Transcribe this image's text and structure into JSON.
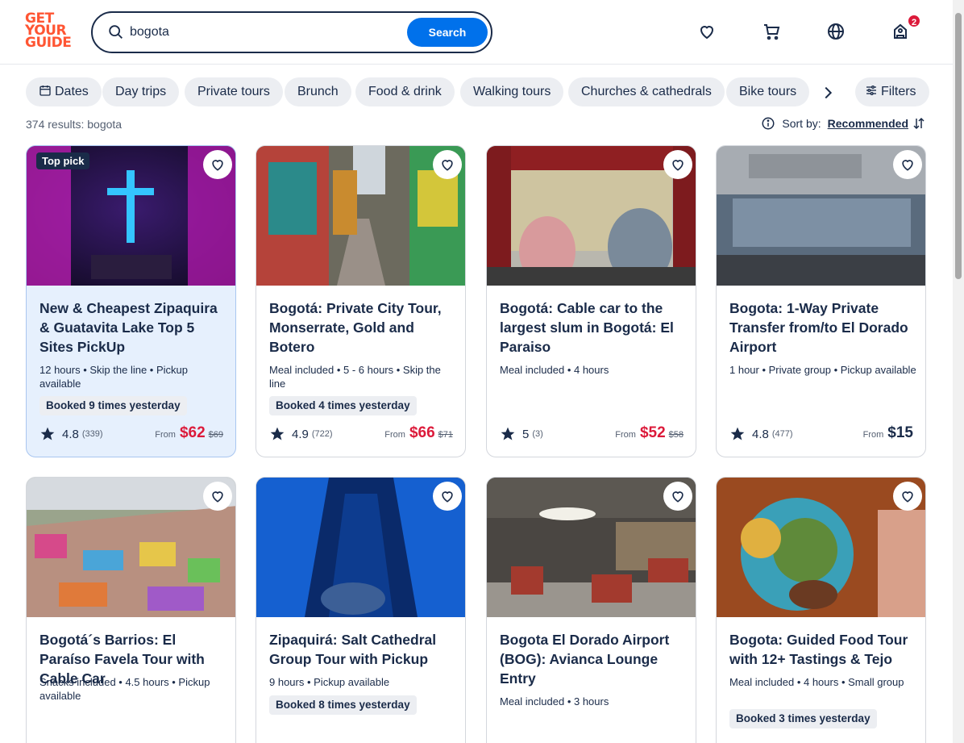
{
  "logo": {
    "line1": "GET",
    "line2": "YOUR",
    "line3": "GUIDE"
  },
  "search": {
    "value": "bogota",
    "button_label": "Search"
  },
  "header": {
    "cart_badge": "2"
  },
  "chips": [
    "Dates",
    "Day trips",
    "Private tours",
    "Brunch",
    "Food & drink",
    "Walking tours",
    "Churches & cathedrals",
    "Bike tours"
  ],
  "filters_label": "Filters",
  "results_text": "374 results: bogota",
  "sort": {
    "label": "Sort by:",
    "value": "Recommended"
  },
  "cards": [
    {
      "title": "New & Cheapest Zipaquira & Guatavita Lake Top 5 Sites PickUp",
      "meta": "12 hours • Skip the line • Pickup available",
      "booked": "Booked 9 times yesterday",
      "badge": "Top pick",
      "rating": "4.8",
      "reviews": "(339)",
      "from": "From",
      "price": "$62",
      "old_price": "$69"
    },
    {
      "title": "Bogotá: Private City Tour, Monserrate, Gold and Botero",
      "meta": "Meal included • 5 - 6 hours • Skip the line",
      "booked": "Booked 4 times yesterday",
      "rating": "4.9",
      "reviews": "(722)",
      "from": "From",
      "price": "$66",
      "old_price": "$71"
    },
    {
      "title": "Bogotá: Cable car to the largest slum in Bogotá: El Paraiso",
      "meta": "Meal included • 4 hours",
      "rating": "5",
      "reviews": "(3)",
      "from": "From",
      "price": "$52",
      "old_price": "$58"
    },
    {
      "title": "Bogota: 1-Way Private Transfer from/to El Dorado Airport",
      "meta": "1 hour • Private group • Pickup available",
      "rating": "4.8",
      "reviews": "(477)",
      "from": "From",
      "price": "$15"
    },
    {
      "title": "Bogotá´s Barrios: El Paraíso Favela Tour with Cable Car",
      "meta": "Snacks included • 4.5 hours • Pickup available"
    },
    {
      "title": "Zipaquirá: Salt Cathedral Group Tour with Pickup",
      "meta": "9 hours • Pickup available",
      "booked": "Booked 8 times yesterday"
    },
    {
      "title": "Bogota El Dorado Airport (BOG): Avianca Lounge Entry",
      "meta": "Meal included • 3 hours"
    },
    {
      "title": "Bogota: Guided Food Tour with 12+ Tastings & Tejo",
      "meta": "Meal included • 4 hours • Small group",
      "booked": "Booked 3 times yesterday"
    }
  ]
}
